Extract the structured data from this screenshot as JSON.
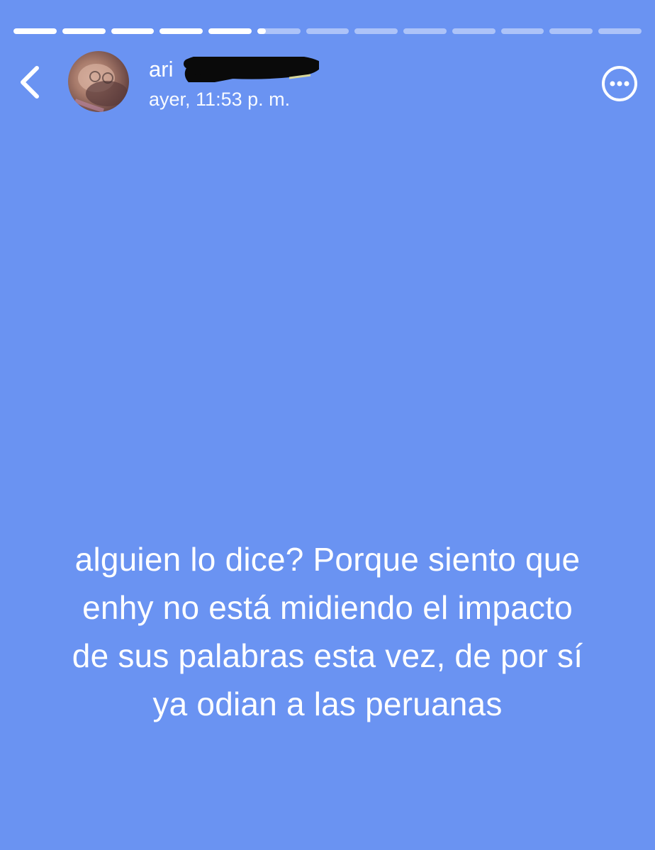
{
  "story": {
    "progress": {
      "segment_count": 13,
      "completed_segments": 5,
      "current_segment_fraction": 0.2
    },
    "header": {
      "user_name": "ari",
      "timestamp": "ayer, 11:53 p. m.",
      "back_icon": "chevron-left-icon",
      "more_icon": "more-options-icon"
    },
    "text_lines": [
      "alguien lo dice? Porque siento que",
      "enhy no está midiendo el impacto",
      "de sus palabras esta vez, de por sí",
      "ya odian a las peruanas"
    ],
    "colors": {
      "background": "#6a93f2",
      "foreground": "#ffffff"
    }
  }
}
